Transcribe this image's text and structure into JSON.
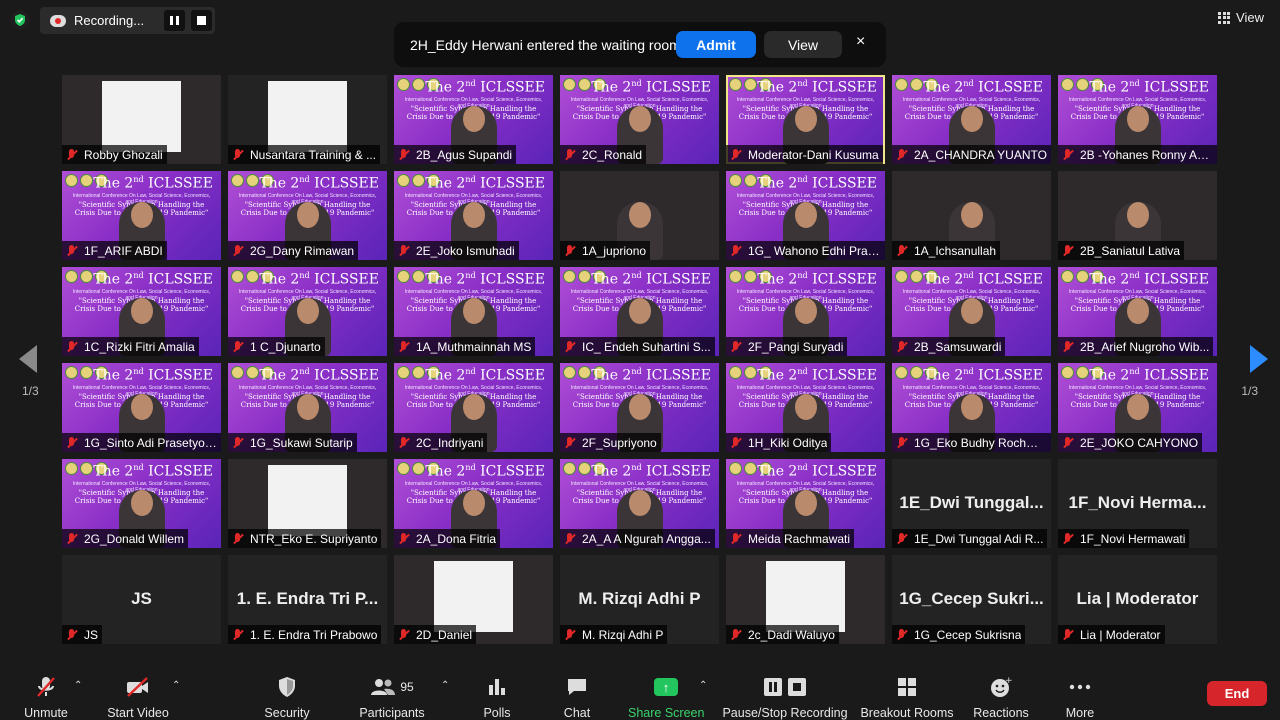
{
  "top": {
    "recording_label": "Recording...",
    "view_label": "View"
  },
  "notification": {
    "message": "2H_Eddy Herwani entered the waiting room",
    "admit_label": "Admit",
    "view_label": "View",
    "close_glyph": "×"
  },
  "pagination": {
    "left": "1/3",
    "right": "1/3"
  },
  "poster": {
    "title": "The 2",
    "title_sup": "nd",
    "title_tail": " ICLSSEE",
    "subtitle": "International Conference On Law, Social Science, Economics, and Education",
    "quote": "\"Scientific Synergy in Handling the Crisis Due to the Covid-19 Pandemic\""
  },
  "tiles": [
    {
      "name": "Robby Ghozali",
      "kind": "photo"
    },
    {
      "name": "Nusantara Training & ...",
      "kind": "logo"
    },
    {
      "name": "2B_Agus Supandi",
      "kind": "poster"
    },
    {
      "name": "2C_Ronald",
      "kind": "poster"
    },
    {
      "name": "Moderator-Dani Kusuma",
      "kind": "poster",
      "selected": true
    },
    {
      "name": "2A_CHANDRA YUANTO",
      "kind": "poster"
    },
    {
      "name": "2B -Yohanes Ronny Agan...",
      "kind": "poster"
    },
    {
      "name": "1F_ARIF ABDI",
      "kind": "poster"
    },
    {
      "name": "2G_Dany Rimawan",
      "kind": "poster"
    },
    {
      "name": "2E_Joko Ismuhadi",
      "kind": "poster"
    },
    {
      "name": "1A_jupriono",
      "kind": "cam"
    },
    {
      "name": "1G_ Wahono Edhi Pras...",
      "kind": "poster"
    },
    {
      "name": "1A_Ichsanullah",
      "kind": "cam"
    },
    {
      "name": "2B_Saniatul Lativa",
      "kind": "cam"
    },
    {
      "name": "1C_Rizki Fitri Amalia",
      "kind": "poster"
    },
    {
      "name": "1 C_Djunarto",
      "kind": "poster"
    },
    {
      "name": "1A_Muthmainnah MS",
      "kind": "poster"
    },
    {
      "name": "IC_ Endeh Suhartini S...",
      "kind": "poster"
    },
    {
      "name": "2F_Pangi Suryadi",
      "kind": "poster"
    },
    {
      "name": "2B_Samsuwardi",
      "kind": "poster"
    },
    {
      "name": "2B_Arief Nugroho Wib...",
      "kind": "poster"
    },
    {
      "name": "1G_Sinto Adi Prasetyor...",
      "kind": "poster"
    },
    {
      "name": "1G_Sukawi Sutarip",
      "kind": "poster"
    },
    {
      "name": "2C_Indriyani",
      "kind": "poster"
    },
    {
      "name": "2F_Supriyono",
      "kind": "poster"
    },
    {
      "name": "1H_Kiki Oditya",
      "kind": "poster"
    },
    {
      "name": "1G_Eko Budhy Rochma...",
      "kind": "poster"
    },
    {
      "name": "2E_JOKO CAHYONO",
      "kind": "poster"
    },
    {
      "name": "2G_Donald Willem",
      "kind": "poster"
    },
    {
      "name": "NTR_Eko E. Supriyanto",
      "kind": "photo"
    },
    {
      "name": "2A_Dona Fitria",
      "kind": "poster"
    },
    {
      "name": "2A_A A Ngurah Angga...",
      "kind": "poster"
    },
    {
      "name": "Meida Rachmawati",
      "kind": "poster"
    },
    {
      "name": "1E_Dwi Tunggal Adi R...",
      "kind": "text",
      "big": "1E_Dwi  Tunggal..."
    },
    {
      "name": "1F_Novi Hermawati",
      "kind": "text",
      "big": "1F_Novi  Herma..."
    },
    {
      "name": "JS",
      "kind": "text",
      "big": "JS"
    },
    {
      "name": "1. E. Endra Tri Prabowo",
      "kind": "text",
      "big": "1. E. Endra Tri P..."
    },
    {
      "name": "2D_Daniel",
      "kind": "photo"
    },
    {
      "name": "M. Rizqi Adhi P",
      "kind": "text",
      "big": "M. Rizqi Adhi P"
    },
    {
      "name": "2c_Dadi Waluyo",
      "kind": "photo"
    },
    {
      "name": "1G_Cecep Sukrisna",
      "kind": "text",
      "big": "1G_Cecep  Sukri..."
    },
    {
      "name": "Lia | Moderator",
      "kind": "text",
      "big": "Lia | Moderator"
    }
  ],
  "toolbar": {
    "unmute": "Unmute",
    "start_video": "Start Video",
    "security": "Security",
    "participants": "Participants",
    "participants_count": "95",
    "polls": "Polls",
    "chat": "Chat",
    "share_screen": "Share Screen",
    "recording": "Pause/Stop Recording",
    "breakout": "Breakout Rooms",
    "reactions": "Reactions",
    "more": "More",
    "end": "End"
  },
  "colors": {
    "accent_blue": "#0e72ed",
    "end_red": "#d7262b",
    "share_green": "#22c55e",
    "poster_purple": "#8a2fc7"
  }
}
